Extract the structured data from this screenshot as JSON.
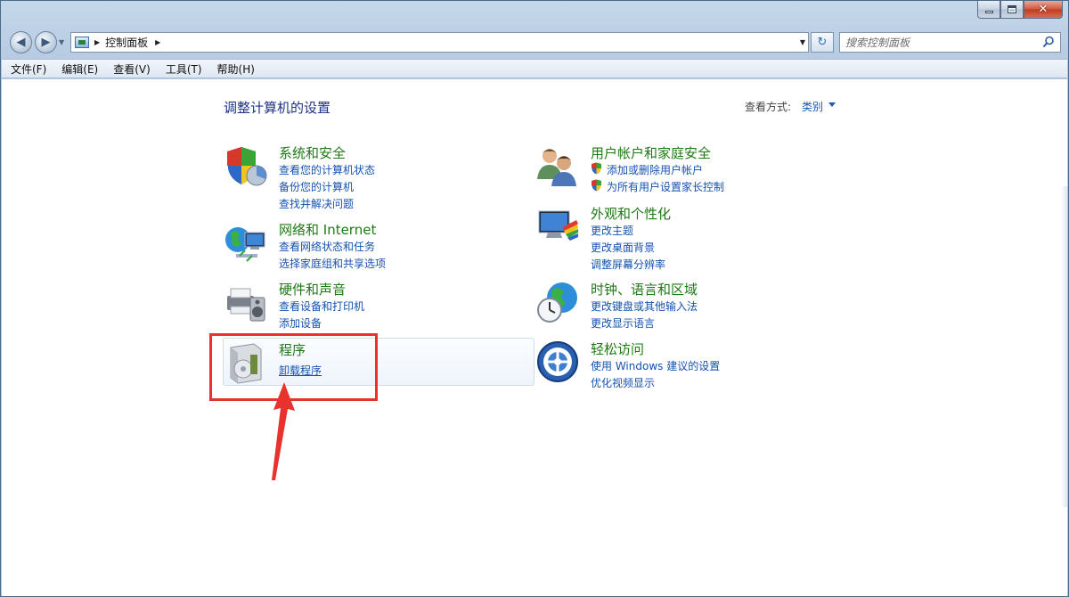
{
  "address": {
    "crumb": "控制面板"
  },
  "search": {
    "placeholder": "搜索控制面板"
  },
  "menu": [
    "文件(F)",
    "编辑(E)",
    "查看(V)",
    "工具(T)",
    "帮助(H)"
  ],
  "page": {
    "title": "调整计算机的设置",
    "view_label": "查看方式:",
    "view_value": "类别"
  },
  "categories": [
    {
      "title": "系统和安全",
      "links": [
        "查看您的计算机状态",
        "备份您的计算机",
        "查找并解决问题"
      ]
    },
    {
      "title": "网络和 Internet",
      "links": [
        "查看网络状态和任务",
        "选择家庭组和共享选项"
      ]
    },
    {
      "title": "硬件和声音",
      "links": [
        "查看设备和打印机",
        "添加设备"
      ]
    },
    {
      "title": "程序",
      "links": [
        "卸载程序"
      ]
    },
    {
      "title": "用户帐户和家庭安全",
      "links": [
        "添加或删除用户帐户",
        "为所有用户设置家长控制"
      ]
    },
    {
      "title": "外观和个性化",
      "links": [
        "更改主题",
        "更改桌面背景",
        "调整屏幕分辨率"
      ]
    },
    {
      "title": "时钟、语言和区域",
      "links": [
        "更改键盘或其他输入法",
        "更改显示语言"
      ]
    },
    {
      "title": "轻松访问",
      "links": [
        "使用 Windows 建议的设置",
        "优化视频显示"
      ]
    }
  ],
  "icons": {
    "close": "✕",
    "back": "◀",
    "forward": "▶",
    "refresh": "↻"
  },
  "colors": {
    "category_title": "#1d7a14",
    "link": "#1552b0",
    "highlight": "#e8322d"
  }
}
